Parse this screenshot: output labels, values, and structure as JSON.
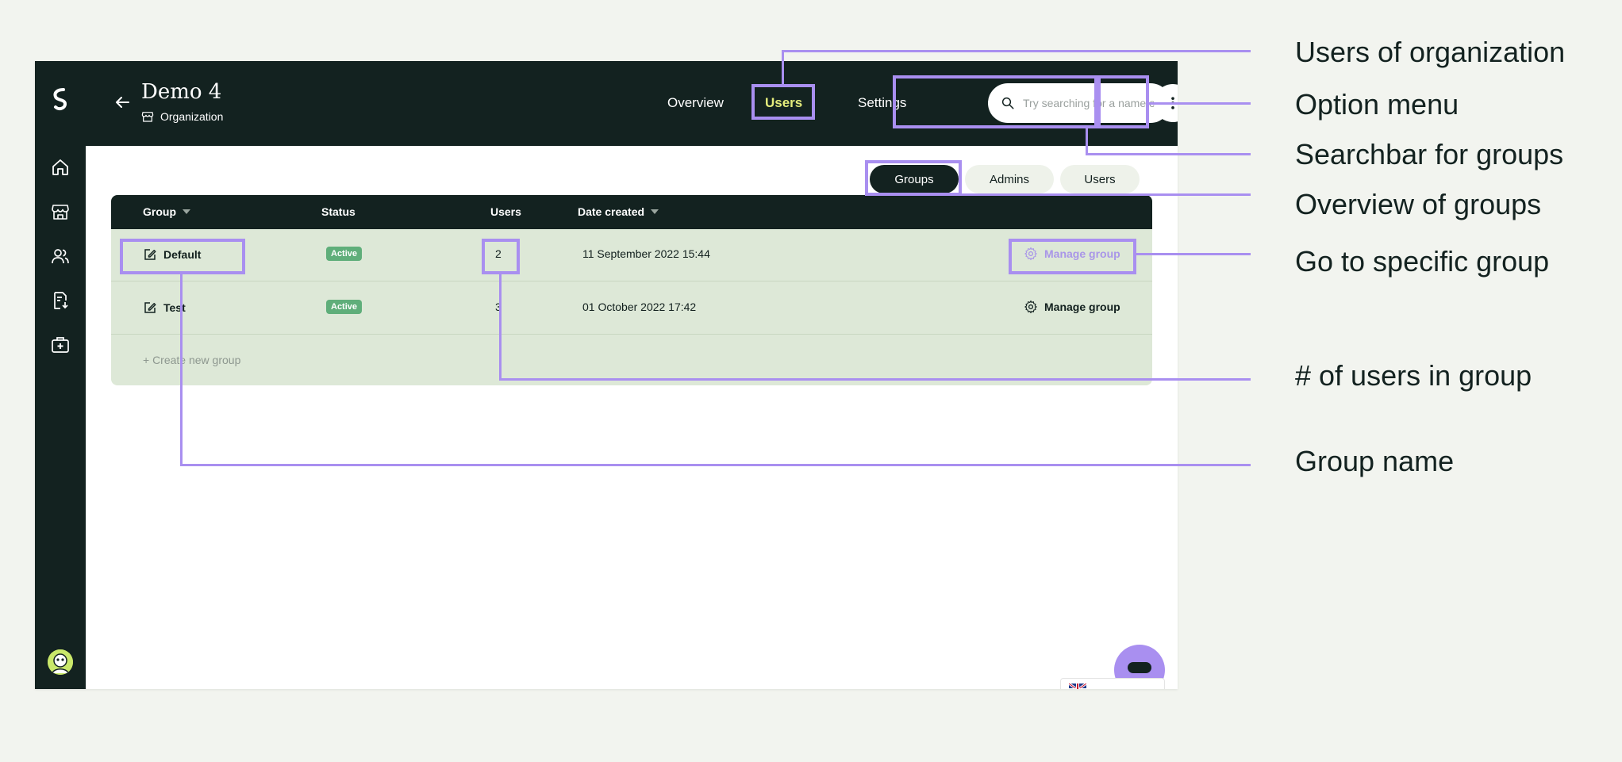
{
  "header": {
    "title": "Demo 4",
    "subtitle": "Organization"
  },
  "nav": [
    {
      "label": "Overview",
      "active": false
    },
    {
      "label": "Users",
      "active": true
    },
    {
      "label": "Settings",
      "active": false
    }
  ],
  "search": {
    "placeholder": "Try searching for a name or e"
  },
  "tabs": [
    {
      "label": "Groups",
      "active": true
    },
    {
      "label": "Admins",
      "active": false
    },
    {
      "label": "Users",
      "active": false
    }
  ],
  "table": {
    "columns": [
      "Group",
      "Status",
      "Users",
      "Date created"
    ],
    "rows": [
      {
        "group": "Default",
        "status": "Active",
        "users": "2",
        "date": "11 September 2022 15:44",
        "action": "Manage group"
      },
      {
        "group": "Test",
        "status": "Active",
        "users": "3",
        "date": "01 October 2022 17:42",
        "action": "Manage group"
      }
    ],
    "create_label": "+ Create new group"
  },
  "sidebar": {
    "icons": [
      "home-icon",
      "store-icon",
      "users-icon",
      "document-download-icon",
      "medical-kit-icon"
    ]
  },
  "annotations": [
    "Users of organization",
    "Option menu",
    "Searchbar for groups",
    "Overview of groups",
    "Go to specific group",
    "# of users in group",
    "Group name"
  ],
  "colors": {
    "dark": "#132220",
    "accent_highlight": "#a98ff0",
    "active_nav": "#e4ec7c",
    "status_active": "#5fae7a",
    "table_bg": "#dde8d7"
  }
}
